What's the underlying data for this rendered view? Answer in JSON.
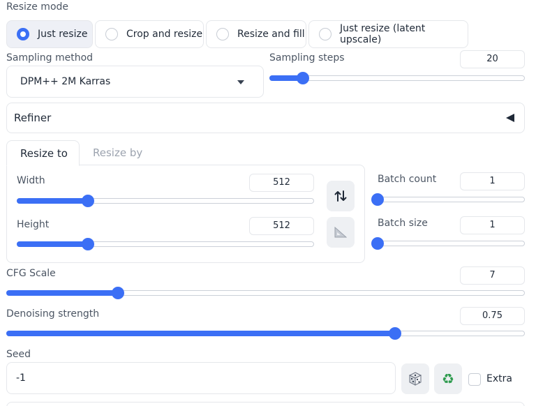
{
  "resize_mode": {
    "label": "Resize mode",
    "options": [
      {
        "label": "Just resize",
        "selected": true
      },
      {
        "label": "Crop and resize",
        "selected": false
      },
      {
        "label": "Resize and fill",
        "selected": false
      },
      {
        "label": "Just resize (latent upscale)",
        "selected": false
      }
    ]
  },
  "sampling_method": {
    "label": "Sampling method",
    "value": "DPM++ 2M Karras"
  },
  "sampling_steps": {
    "label": "Sampling steps",
    "value": "20",
    "level": 0.13
  },
  "refiner": {
    "label": "Refiner"
  },
  "tabs": {
    "resize_to": "Resize to",
    "resize_by": "Resize by"
  },
  "width": {
    "label": "Width",
    "value": "512",
    "level": 0.24
  },
  "height": {
    "label": "Height",
    "value": "512",
    "level": 0.24
  },
  "batch_count": {
    "label": "Batch count",
    "value": "1",
    "level": 0.0
  },
  "batch_size": {
    "label": "Batch size",
    "value": "1",
    "level": 0.0
  },
  "cfg_scale": {
    "label": "CFG Scale",
    "value": "7",
    "level": 0.216
  },
  "denoising": {
    "label": "Denoising strength",
    "value": "0.75",
    "level": 0.75
  },
  "seed": {
    "label": "Seed",
    "value": "-1",
    "extra_label": "Extra"
  },
  "colors": {
    "accent": "#3b6ff5",
    "recycle_green": "#2e9b4e"
  }
}
